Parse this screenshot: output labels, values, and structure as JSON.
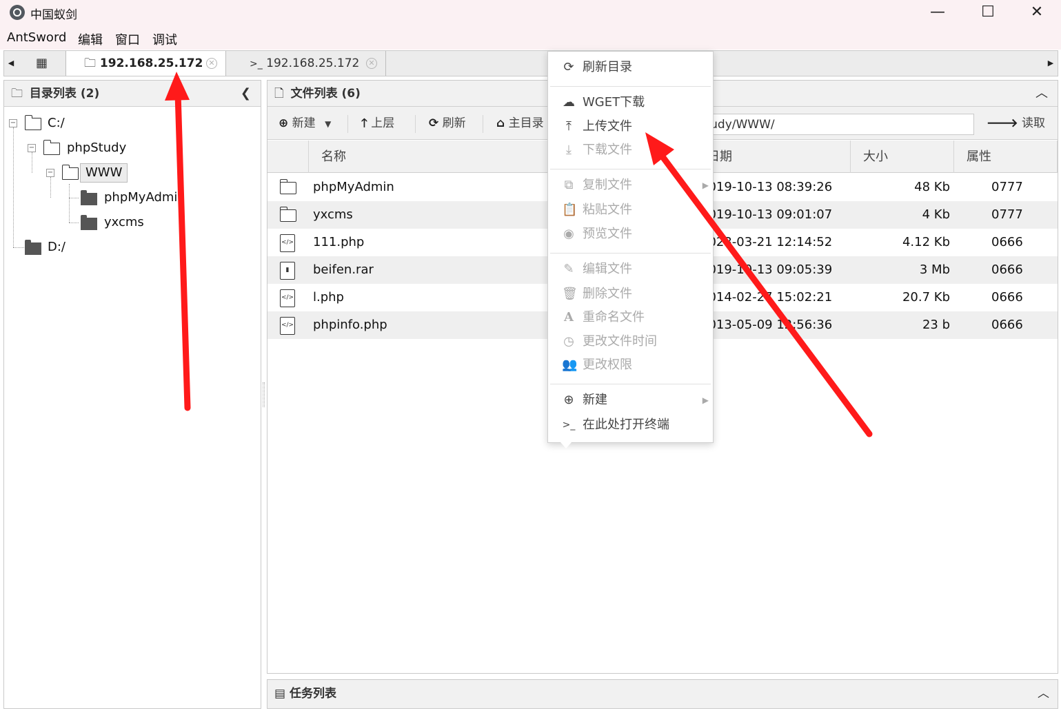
{
  "window": {
    "title": "中国蚁剑",
    "minimize": "—",
    "maximize": "☐",
    "close": "✕"
  },
  "menubar": [
    "AntSword",
    "编辑",
    "窗口",
    "调试"
  ],
  "tabs": {
    "grid_icon": "▦",
    "items": [
      {
        "label": "192.168.25.172",
        "icon": "🗀",
        "active": true
      },
      {
        "label": "192.168.25.172",
        "icon": ">_",
        "active": false
      }
    ],
    "left_arrow": "◀",
    "right_arrow": "▶",
    "close_glyph": "✕"
  },
  "dir_panel": {
    "title": "目录列表 (2)",
    "collapse": "❮",
    "tree": [
      {
        "label": "C:/",
        "toggle": "−"
      },
      {
        "label": "phpStudy",
        "toggle": "−"
      },
      {
        "label": "WWW",
        "toggle": "−"
      },
      {
        "label": "phpMyAdmin"
      },
      {
        "label": "yxcms"
      },
      {
        "label": "D:/"
      }
    ]
  },
  "file_panel": {
    "title": "文件列表 (6)",
    "collapse": "︿",
    "toolbar": {
      "new": "新建",
      "up": "上层",
      "refresh": "刷新",
      "home": "主目录",
      "path": "C:/phpStudy/WWW/",
      "read": "读取"
    },
    "columns": [
      "名称",
      "日期",
      "大小",
      "属性"
    ],
    "rows": [
      {
        "name": "phpMyAdmin",
        "date": "2019-10-13 08:39:26",
        "size": "48 Kb",
        "attr": "0777",
        "kind": "folder"
      },
      {
        "name": "yxcms",
        "date": "2019-10-13 09:01:07",
        "size": "4 Kb",
        "attr": "0777",
        "kind": "folder"
      },
      {
        "name": "111.php",
        "date": "2023-03-21 12:14:52",
        "size": "4.12 Kb",
        "attr": "0666",
        "kind": "code"
      },
      {
        "name": "beifen.rar",
        "date": "2019-10-13 09:05:39",
        "size": "3 Mb",
        "attr": "0666",
        "kind": "archive"
      },
      {
        "name": "l.php",
        "date": "2014-02-27 15:02:21",
        "size": "20.7 Kb",
        "attr": "0666",
        "kind": "code"
      },
      {
        "name": "phpinfo.php",
        "date": "2013-05-09 12:56:36",
        "size": "23 b",
        "attr": "0666",
        "kind": "code"
      }
    ]
  },
  "task_panel": {
    "title": "任务列表",
    "collapse": "︿"
  },
  "context_menu": {
    "items": [
      {
        "label": "刷新目录",
        "icon": "⟳"
      },
      {
        "label": "WGET下载",
        "icon": "☁"
      },
      {
        "label": "上传文件",
        "icon": "⤒"
      },
      {
        "label": "下载文件",
        "icon": "⤓"
      },
      {
        "label": "复制文件",
        "icon": "⧉"
      },
      {
        "label": "粘贴文件",
        "icon": "📋"
      },
      {
        "label": "预览文件",
        "icon": "◉"
      },
      {
        "label": "编辑文件",
        "icon": "✎"
      },
      {
        "label": "删除文件",
        "icon": "🗑"
      },
      {
        "label": "重命名文件",
        "icon": "A"
      },
      {
        "label": "更改文件时间",
        "icon": "◷"
      },
      {
        "label": "更改权限",
        "icon": "👥"
      },
      {
        "label": "新建",
        "icon": "⊕"
      },
      {
        "label": "在此处打开终端",
        "icon": ">_"
      }
    ]
  },
  "annotation_color": "#ff1a1a"
}
